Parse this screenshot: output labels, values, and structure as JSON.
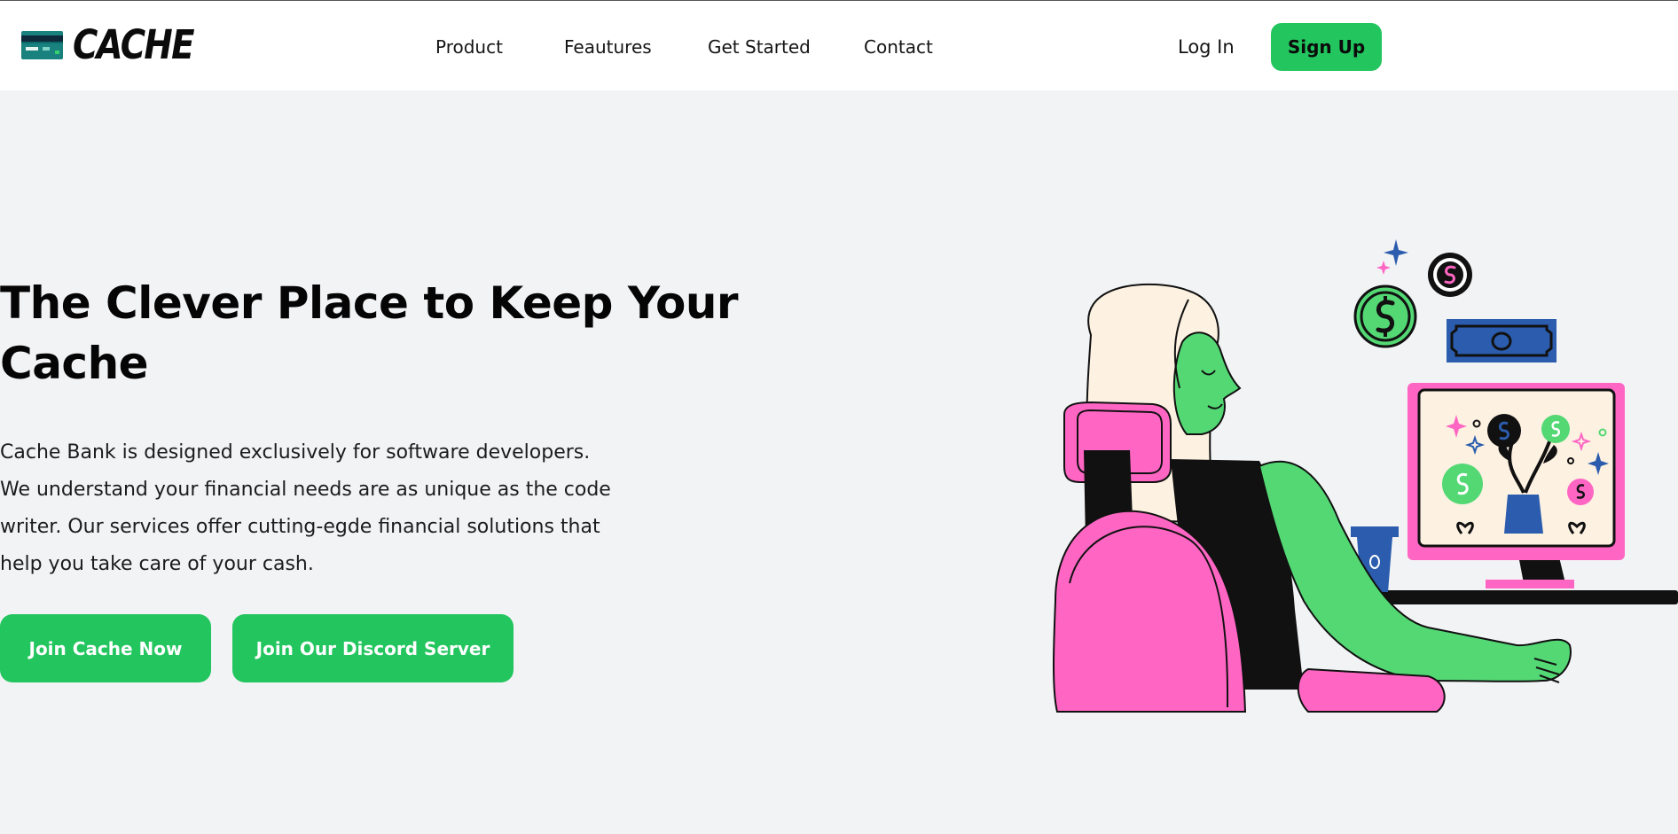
{
  "brand": {
    "name": "CACHE",
    "logo_icon": "credit-card-icon"
  },
  "nav": {
    "links": [
      {
        "label": "Product"
      },
      {
        "label": "Feautures"
      },
      {
        "label": "Get Started"
      },
      {
        "label": "Contact"
      }
    ],
    "login_label": "Log In",
    "signup_label": "Sign Up"
  },
  "hero": {
    "title": "The Clever Place to Keep Your Cache",
    "description": "Cache Bank is designed exclusively for software developers. We understand your financial needs are as unique as the code writer. Our services offer cutting-egde financial solutions that help you take care of your cash.",
    "primary_cta": "Join Cache Now",
    "secondary_cta": "Join Our Discord Server",
    "illustration": "woman-at-computer-illustration"
  },
  "colors": {
    "accent": "#22c55e",
    "background": "#f2f3f5",
    "header_bg": "#ffffff",
    "illustration_pink": "#ff66c4",
    "illustration_green": "#53d874",
    "illustration_blue": "#2b5cad",
    "illustration_cream": "#fdf1e1"
  }
}
